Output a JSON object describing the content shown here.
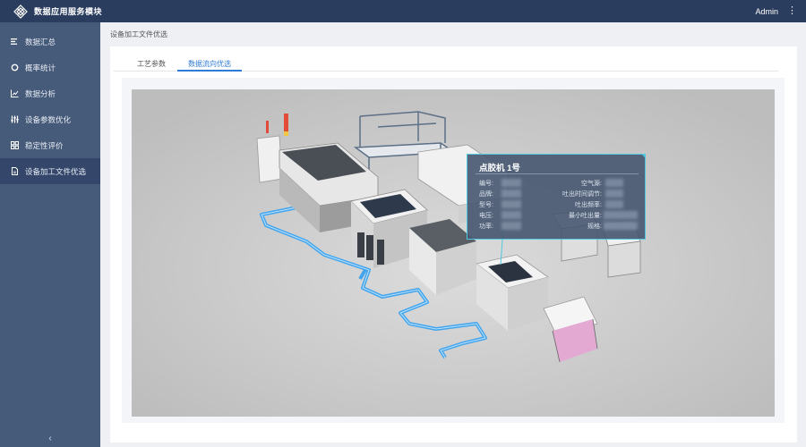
{
  "header": {
    "app_title": "数据应用服务模块",
    "user": "Admin",
    "more": "⋮"
  },
  "sidebar": {
    "items": [
      {
        "label": "数据汇总",
        "icon": "list-icon",
        "active": false
      },
      {
        "label": "概率统计",
        "icon": "ring-icon",
        "active": false
      },
      {
        "label": "数据分析",
        "icon": "line-chart-icon",
        "active": false
      },
      {
        "label": "设备参数优化",
        "icon": "sliders-icon",
        "active": false
      },
      {
        "label": "稳定性评价",
        "icon": "grid-icon",
        "active": false
      },
      {
        "label": "设备加工文件优选",
        "icon": "file-icon",
        "active": true
      }
    ],
    "collapse": "‹"
  },
  "main": {
    "breadcrumb": "设备加工文件优选",
    "tabs": [
      {
        "label": "工艺参数",
        "active": false
      },
      {
        "label": "数据流向优选",
        "active": true
      }
    ]
  },
  "popup": {
    "title": "点胶机 1号",
    "left_labels": [
      "编号:",
      "品牌:",
      "型号:",
      "电压:",
      "功率:"
    ],
    "right_labels": [
      "空气源:",
      "吐出时间调节:",
      "吐出频率:",
      "最小吐出量:",
      "规格:"
    ]
  },
  "colors": {
    "topbar": "#2b3d5e",
    "sidebar": "#465a79",
    "sidebar_active": "#34476a",
    "accent": "#2e7bd6",
    "conveyor": "#3aa2ee",
    "popup_border": "#4fc7df"
  }
}
